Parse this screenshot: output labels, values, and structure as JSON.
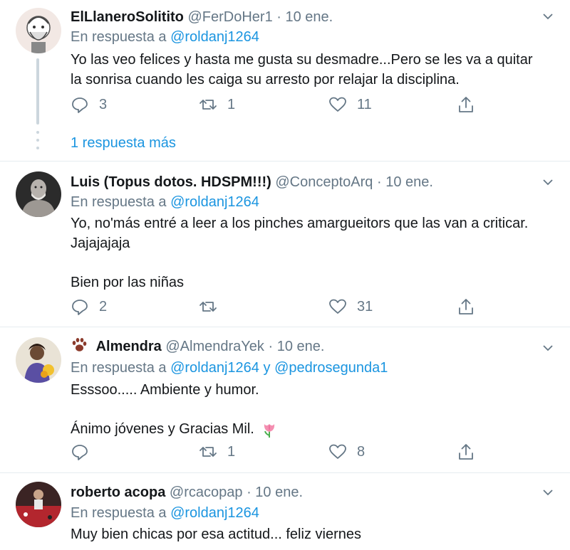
{
  "tweets": [
    {
      "name": "ElLlaneroSolitito",
      "handle": "@FerDoHer1",
      "sep": "·",
      "time": "10 ene.",
      "reply_prefix": "En respuesta a",
      "reply_users": [
        "@roldanj1264"
      ],
      "lines": [
        "Yo las veo felices y hasta me gusta su desmadre...Pero se les va a quitar",
        "la sonrisa cuando les caiga su arresto por relajar la disciplina."
      ],
      "replies": "3",
      "retweets": "1",
      "likes": "11"
    },
    {
      "name": "Luis (Topus dotos. HDSPM!!!)",
      "handle": "@ConceptoArq",
      "sep": "·",
      "time": "10 ene.",
      "reply_prefix": "En respuesta a",
      "reply_users": [
        "@roldanj1264"
      ],
      "lines": [
        "Yo, no'más entré a leer a los pinches amargueitors que las van a criticar.",
        "Jajajajaja",
        "",
        "Bien por las niñas"
      ],
      "replies": "2",
      "retweets": "",
      "likes": "31"
    },
    {
      "name_prefix_icon": "paw-prints-icon",
      "name": "Almendra",
      "handle": "@AlmendraYek",
      "sep": "·",
      "time": "10 ene.",
      "reply_prefix": "En respuesta a",
      "reply_users": [
        "@roldanj1264",
        "@pedrosegunda1"
      ],
      "reply_joiner": "y",
      "lines": [
        "Esssoo..... Ambiente y humor.",
        "",
        "Ánimo jóvenes y Gracias Mil."
      ],
      "line_emoji": "tulip-icon",
      "replies": "",
      "retweets": "1",
      "likes": "8"
    },
    {
      "name": "roberto acopa",
      "handle": "@rcacopap",
      "sep": "·",
      "time": "10 ene.",
      "reply_prefix": "En respuesta a",
      "reply_users": [
        "@roldanj1264"
      ],
      "lines": [
        "Muy bien chicas por esa actitud... feliz viernes"
      ]
    }
  ],
  "thread": {
    "more_replies_label": "1 respuesta más"
  },
  "colors": {
    "accent": "#1b95e0",
    "muted": "#657786",
    "text": "#14171a",
    "divider": "#e6ecf0"
  }
}
